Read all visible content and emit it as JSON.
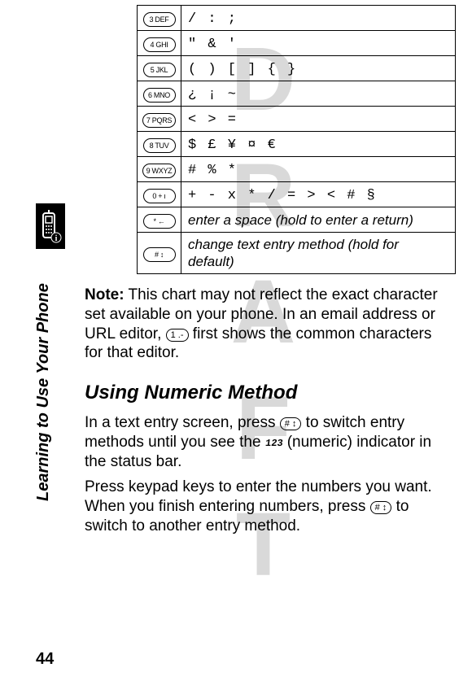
{
  "watermark": "DRAFT",
  "sidebar_label": "Learning to Use Your Phone",
  "page_number": "44",
  "keys": [
    {
      "label": "3 DEF",
      "chars": "/  :  ;"
    },
    {
      "label": "4 GHI",
      "chars": "\"  &  '"
    },
    {
      "label": "5 JKL",
      "chars": "(  )  [  ]  {  }"
    },
    {
      "label": "6 MNO",
      "chars": "¿  ¡  ~"
    },
    {
      "label": "7 PQRS",
      "chars": "<  >  ="
    },
    {
      "label": "8 TUV",
      "chars": "$  £  ¥  ¤  €"
    },
    {
      "label": "9 WXYZ",
      "chars": "#  %  *"
    },
    {
      "label": "0 + ı",
      "chars": "+ - x * / = > < # §"
    },
    {
      "label": "* ←",
      "note": "enter a space (hold to enter a return)"
    },
    {
      "label": "# ↕",
      "note": "change text entry method (hold for default)"
    }
  ],
  "note": {
    "prefix": "Note:",
    "before_key": " This chart may not reflect the exact character set available on your phone. In an email address or URL editor, ",
    "inline_key": "1 .-",
    "after_key": " first shows the common characters for that editor."
  },
  "heading": "Using Numeric Method",
  "p1": {
    "a": "In a text entry screen, press ",
    "key1": "# ↕",
    "b": " to switch entry methods until you see the ",
    "indicator": "123",
    "c": " (numeric) indicator in the status bar."
  },
  "p2": {
    "a": "Press keypad keys to enter the numbers you want. When you finish entering numbers, press ",
    "key1": "# ↕",
    "b": " to switch to another entry method."
  }
}
